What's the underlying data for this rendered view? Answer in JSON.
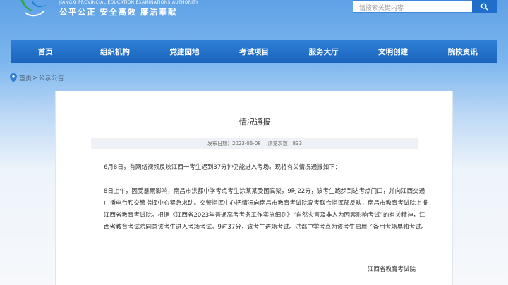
{
  "header": {
    "org_en": "JIANGXI PROVINCIAL EDUCATION EXAMINATIONS AUTHORITY",
    "slogan": "公平公正  安全高效  廉洁奉献",
    "search_placeholder": "请搜索关键内容"
  },
  "nav": {
    "items": [
      {
        "label": "首页"
      },
      {
        "label": "组织机构"
      },
      {
        "label": "党建园地"
      },
      {
        "label": "考试项目"
      },
      {
        "label": "服务大厅"
      },
      {
        "label": "文明创建"
      },
      {
        "label": "院校资讯"
      }
    ]
  },
  "breadcrumb": {
    "home": "首页",
    "separator": ">",
    "current": "公示公告"
  },
  "article": {
    "title": "情况通报",
    "publish_label": "发布日期：",
    "publish_date": "2023-06-08",
    "views_label": "浏览次数：",
    "views": "833",
    "paragraph1": "6月8日，有网络视频反映江西一考生迟到37分钟仍能进入考场。现将有关情况通报如下：",
    "paragraph2": "8日上午，因受暴雨影响，南昌市洪都中学考点考生涂某某受困高架，9时22分，该考生跑步到达考点门口，并向江西交通广播电台和交警指挥中心紧急求助。交警指挥中心把情况向南昌市教育考试院高考联合指挥部反映，南昌市教育考试院上报江西省教育考试院。根据《江西省2023年普通高考考务工作实施细则》“自然灾害及非人为因素影响考试”的有关精神，江西省教育考试院同意该考生进入考场考试。9时37分，该考生进场考试。洪都中学考点为该考生启用了备用考场单独考试。",
    "signature": "江西省教育考试院"
  },
  "colors": {
    "nav_bg": "#1a64bd",
    "accent": "#1f6fca"
  }
}
